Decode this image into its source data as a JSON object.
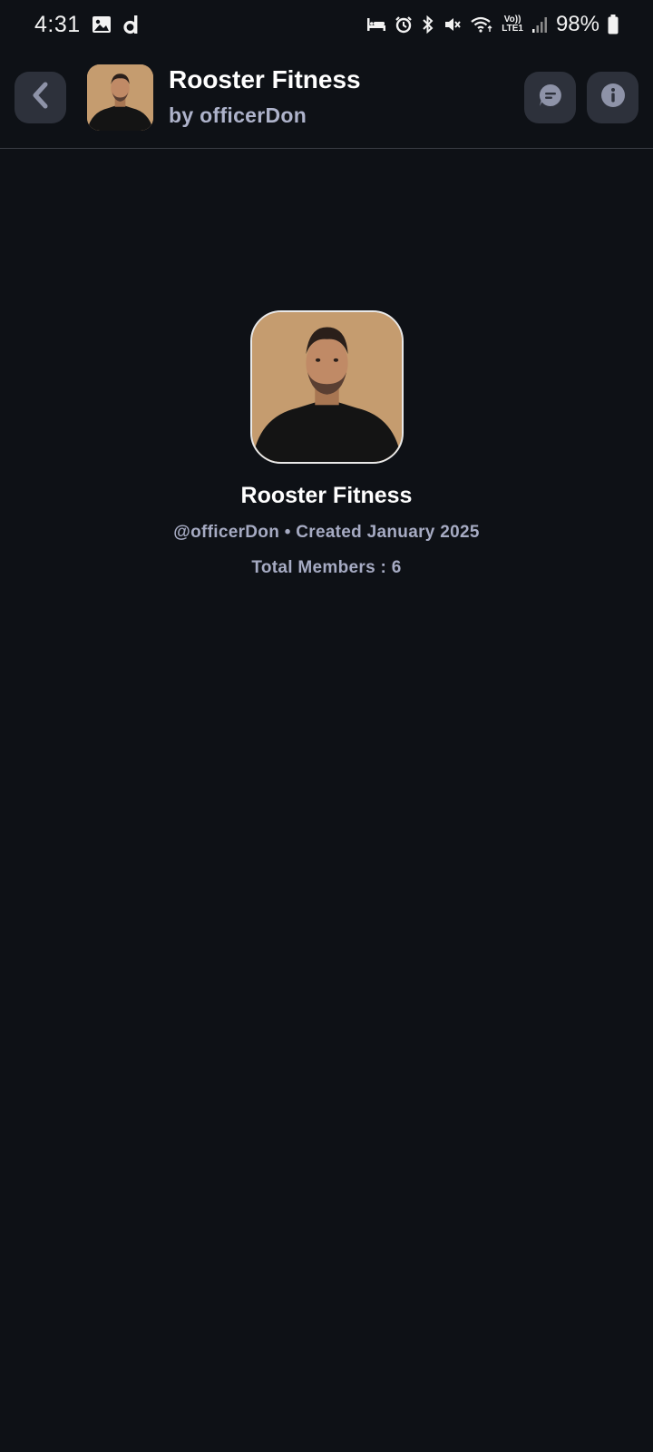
{
  "status_bar": {
    "time": "4:31",
    "battery": "98%",
    "network_label_top": "Vo))",
    "network_label_bottom": "LTE1",
    "icons": [
      "gallery-icon",
      "d-app-icon",
      "sleep-icon",
      "alarm-icon",
      "bluetooth-icon",
      "mute-icon",
      "wifi-icon",
      "signal-icon",
      "battery-icon"
    ]
  },
  "header": {
    "title": "Rooster Fitness",
    "subtitle": "by officerDon",
    "back_icon": "chevron-left-icon",
    "chat_icon": "chat-bubble-icon",
    "info_icon": "info-icon"
  },
  "profile": {
    "name": "Rooster Fitness",
    "meta": "@officerDon • Created January 2025",
    "members": "Total Members : 6"
  },
  "colors": {
    "background": "#0e1116",
    "button_bg": "#2d313b",
    "icon_color": "#8e93a8",
    "muted_text": "#a6abc3",
    "avatar_bg": "#c59c6f"
  }
}
